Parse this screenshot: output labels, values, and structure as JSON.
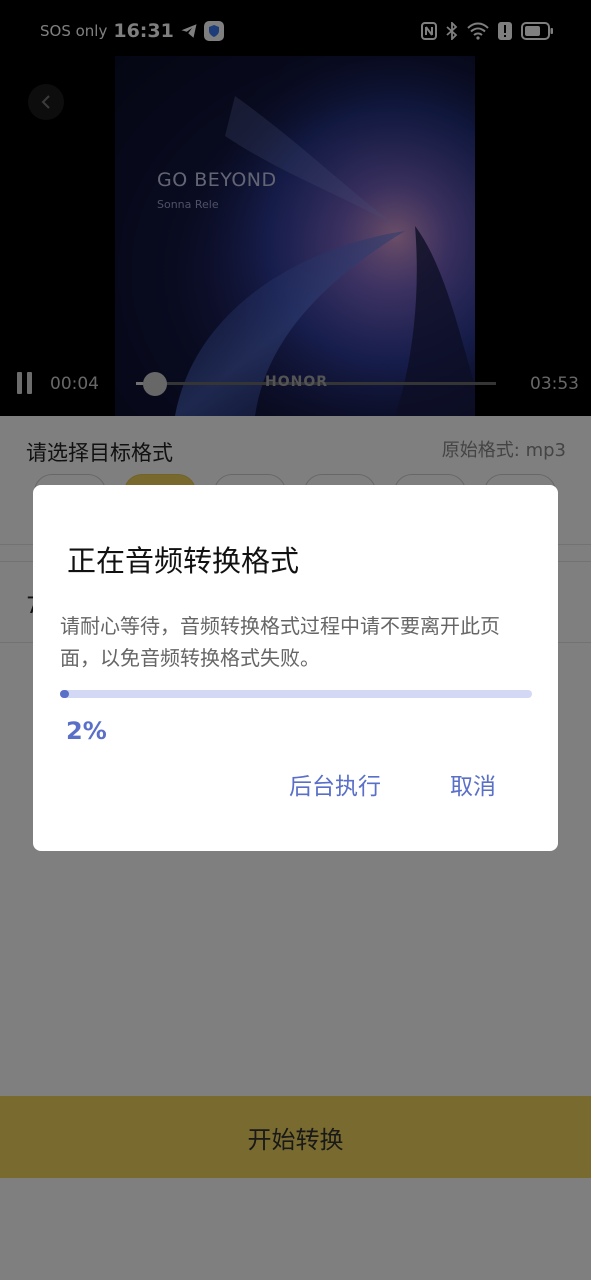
{
  "status_bar": {
    "carrier": "SOS only",
    "time": "16:31",
    "icons": [
      "telegram-icon",
      "shield-icon",
      "nfc-icon",
      "bluetooth-icon",
      "wifi-icon",
      "alert-icon",
      "battery-icon"
    ]
  },
  "player": {
    "cover_title": "GO BEYOND",
    "cover_artist": "Sonna Rele",
    "watermark": "HONOR",
    "current_time": "00:04",
    "total_time": "03:53",
    "progress": 0.02,
    "icons": [
      "back-icon",
      "pause-icon"
    ]
  },
  "format_section": {
    "title": "请选择目标格式",
    "original_format": "原始格式: mp3",
    "selected_index": 1,
    "row_label": "7"
  },
  "start_button": {
    "label": "开始转换"
  },
  "dialog": {
    "title": "正在音频转换格式",
    "message": "请耐心等待，音频转换格式过程中请不要离开此页面，以免音频转换格式失败。",
    "progress_percent": 2,
    "progress_text": "2%",
    "background_button": "后台执行",
    "cancel_button": "取消"
  },
  "colors": {
    "accent": "#5a6fc8",
    "progress_track": "#d3d8f4",
    "start_button": "#f3d75e",
    "selected_chip": "#f0d25f"
  }
}
